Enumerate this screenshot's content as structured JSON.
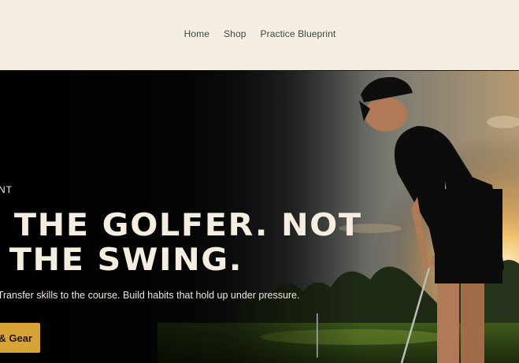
{
  "nav": {
    "items": [
      {
        "label": "Home"
      },
      {
        "label": "Shop"
      },
      {
        "label": "Practice Blueprint"
      }
    ]
  },
  "hero": {
    "eyebrow": "NT",
    "headline_line1": "D THE GOLFER. NOT",
    "headline_line2": "T THE SWING.",
    "subtitle": ". Transfer skills to the course. Build habits that hold up under pressure.",
    "cta_label": "& Gear"
  },
  "colors": {
    "page_bg": "#f5efe3",
    "nav_text": "#3a4a40",
    "hero_text": "#f4ede0",
    "cta_bg": "#d7a436"
  }
}
